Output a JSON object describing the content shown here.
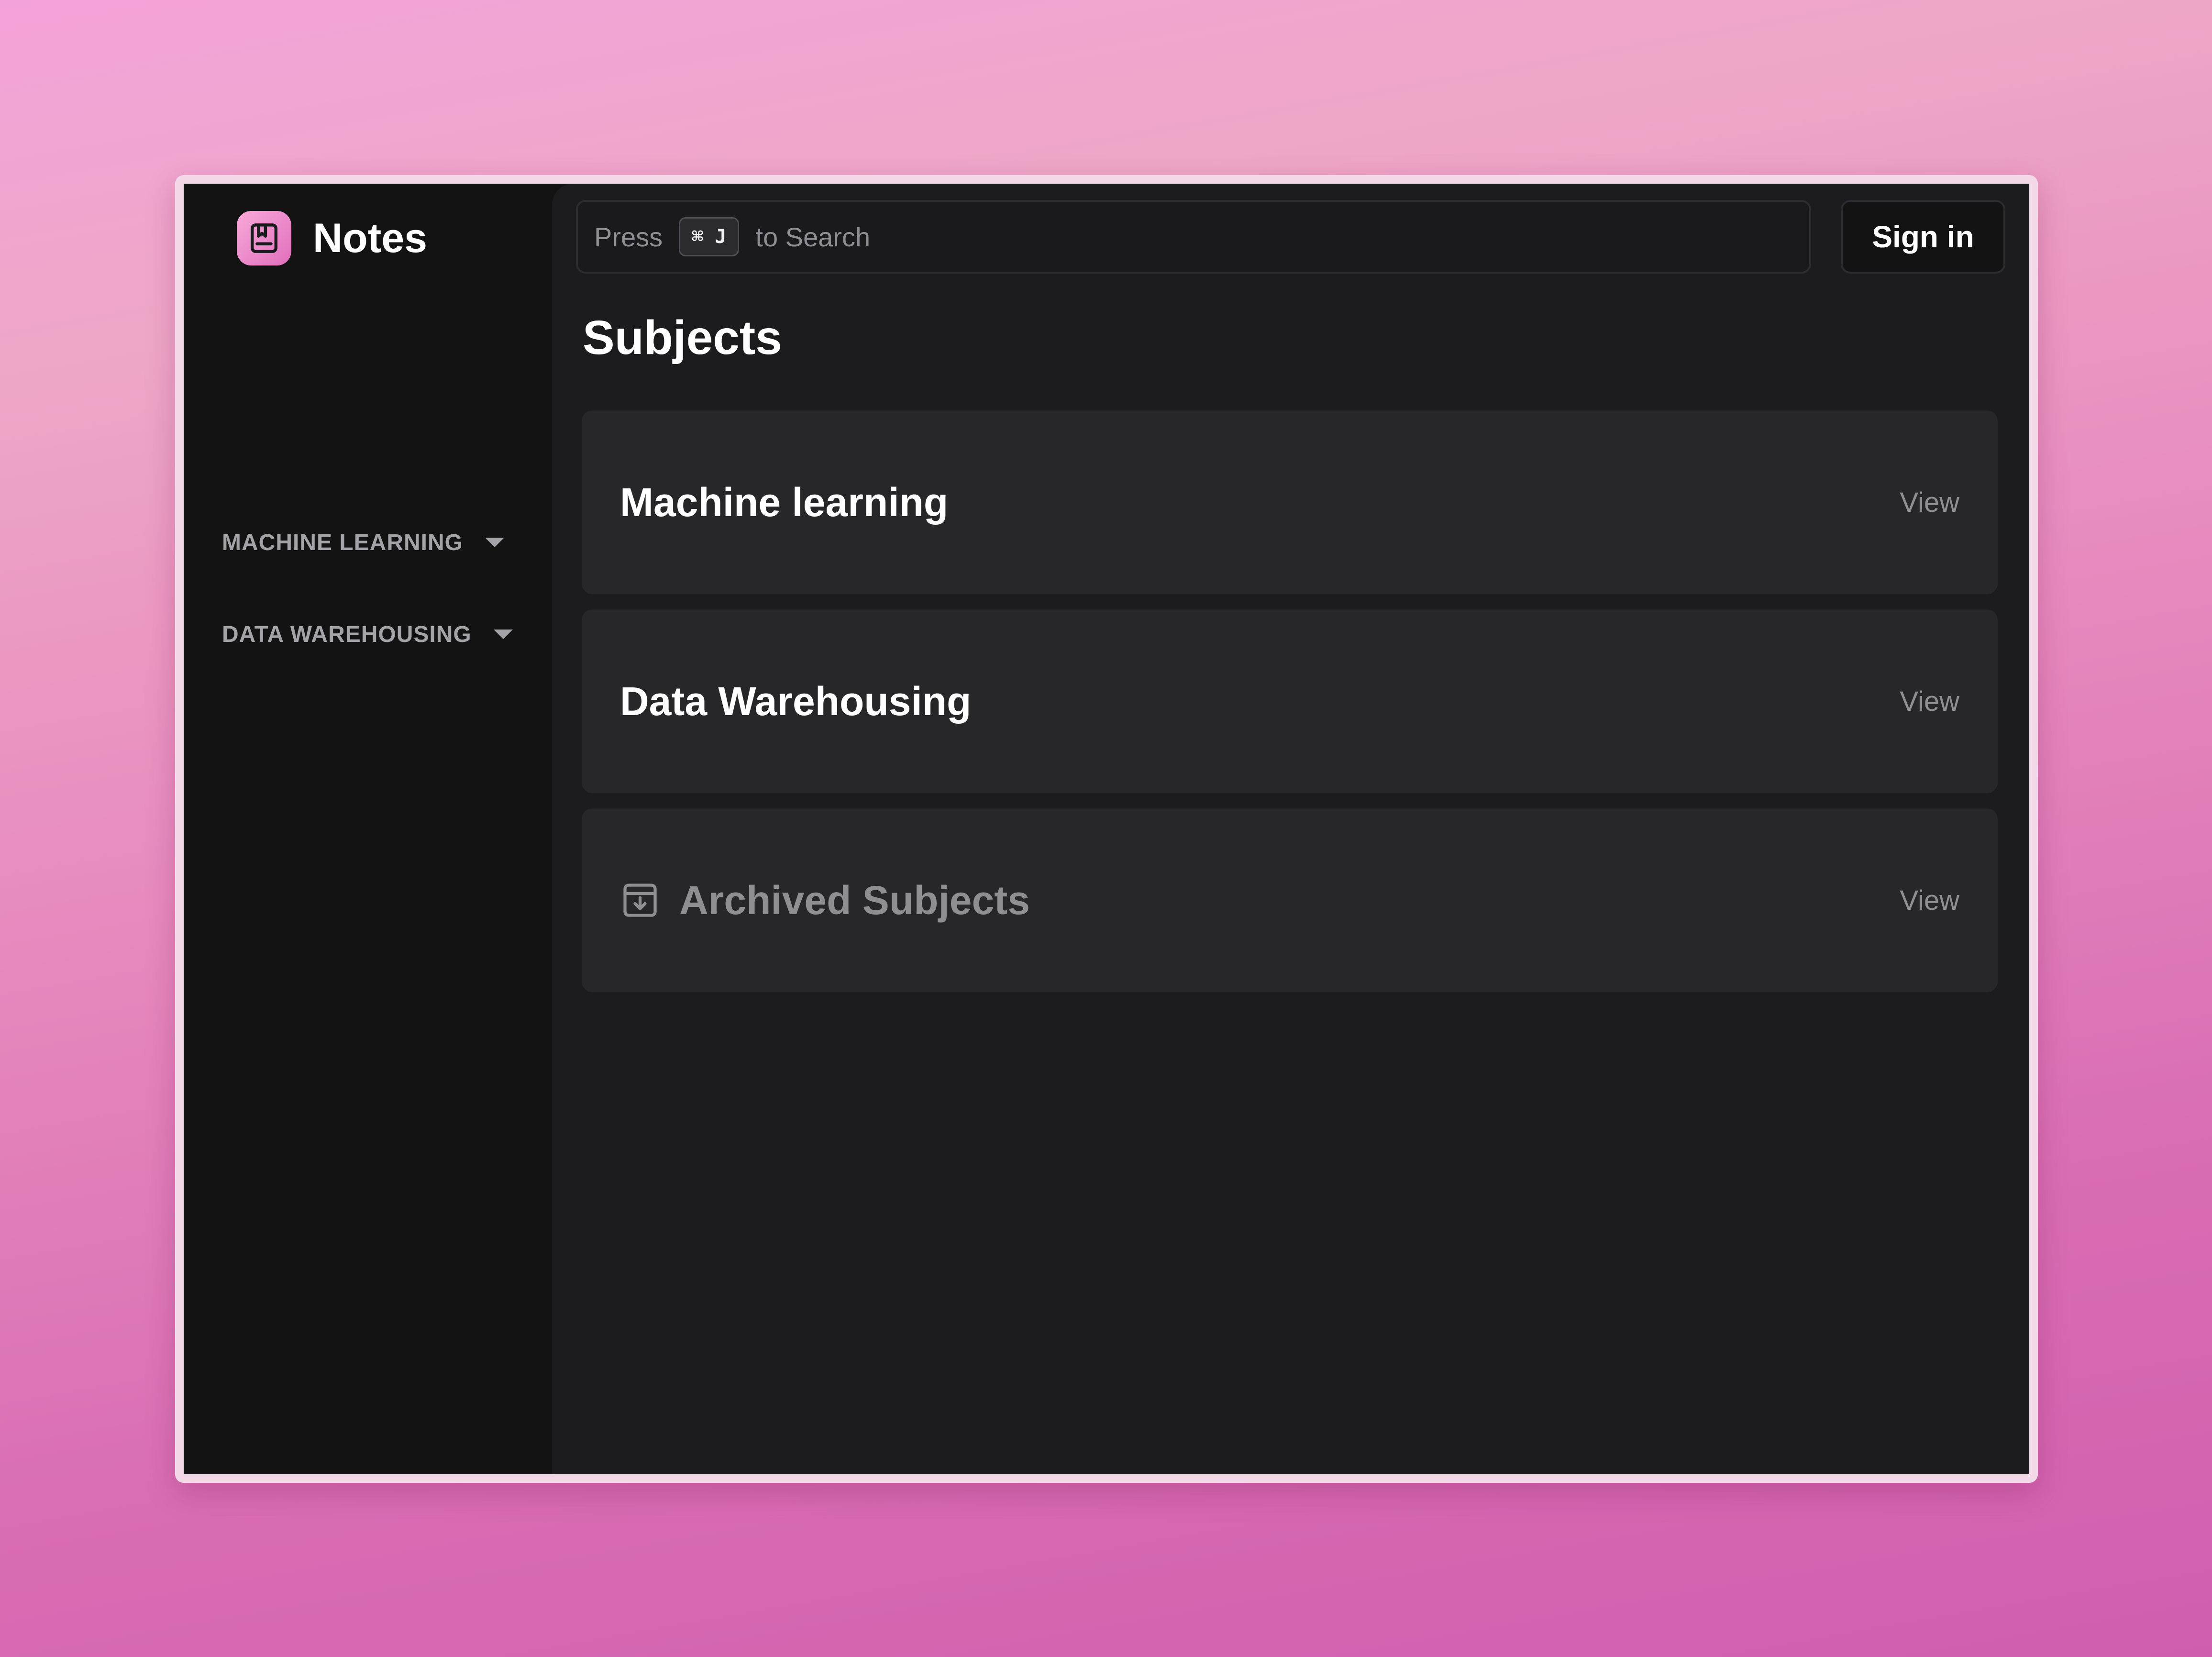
{
  "app": {
    "title": "Notes",
    "logo_icon": "bookmark-book-icon",
    "accent_color": "#ee8ac8"
  },
  "sidebar": {
    "items": [
      {
        "label": "MACHINE LEARNING",
        "icon": "caret-down-icon"
      },
      {
        "label": "DATA WAREHOUSING",
        "icon": "caret-down-icon"
      }
    ]
  },
  "header": {
    "search": {
      "prefix": "Press",
      "shortcut": "⌘ J",
      "suffix": "to Search"
    },
    "signin_label": "Sign in"
  },
  "main": {
    "title": "Subjects",
    "subjects": [
      {
        "title": "Machine learning",
        "action": "View"
      },
      {
        "title": "Data Warehousing",
        "action": "View"
      },
      {
        "title": "Archived Subjects",
        "action": "View",
        "icon": "archive-icon"
      }
    ]
  }
}
